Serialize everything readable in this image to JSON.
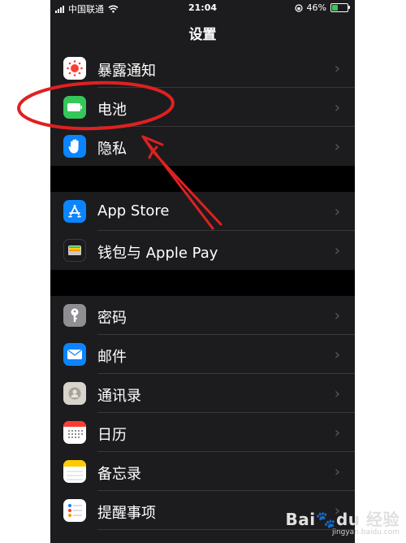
{
  "status_bar": {
    "carrier": "中国联通",
    "time": "21:04",
    "battery": "46%",
    "battery_level": 0.46
  },
  "nav": {
    "title": "设置"
  },
  "groups": [
    {
      "items": [
        {
          "label": "暴露通知",
          "icon": "exposure-notification-icon",
          "icon_color": "#ffffff"
        },
        {
          "label": "电池",
          "icon": "battery-icon",
          "icon_color": "#34c759"
        },
        {
          "label": "隐私",
          "icon": "privacy-hand-icon",
          "icon_color": "#0a84ff"
        }
      ]
    },
    {
      "items": [
        {
          "label": "App Store",
          "icon": "app-store-icon",
          "icon_color": "#0a84ff"
        },
        {
          "label": "钱包与 Apple Pay",
          "icon": "wallet-icon",
          "icon_color": "#1c1c1e"
        }
      ]
    },
    {
      "items": [
        {
          "label": "密码",
          "icon": "key-icon",
          "icon_color": "#8e8e93"
        },
        {
          "label": "邮件",
          "icon": "mail-icon",
          "icon_color": "#0a84ff"
        },
        {
          "label": "通讯录",
          "icon": "contacts-icon",
          "icon_color": "#c7c7cc"
        },
        {
          "label": "日历",
          "icon": "calendar-icon",
          "icon_color": "#ffffff"
        },
        {
          "label": "备忘录",
          "icon": "notes-icon",
          "icon_color": "#ffffff"
        },
        {
          "label": "提醒事项",
          "icon": "reminders-icon",
          "icon_color": "#ffffff"
        }
      ]
    }
  ],
  "annotation": {
    "color": "#e02020"
  },
  "watermark": {
    "logo_a": "Bai",
    "logo_b": "du",
    "logo_c": "经验",
    "sub": "jingyan.baidu.com"
  }
}
